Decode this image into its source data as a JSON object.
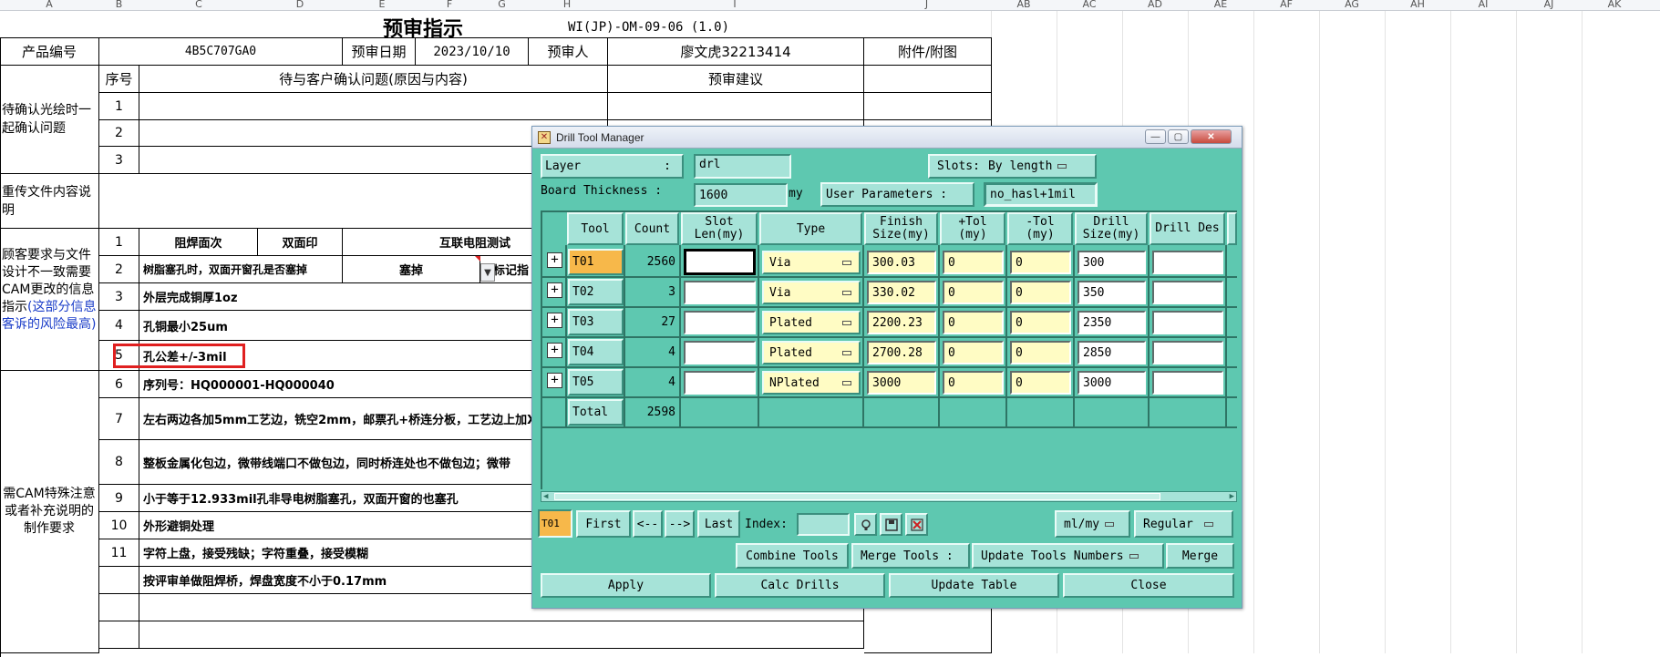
{
  "column_letters": [
    "A",
    "B",
    "C",
    "D",
    "E",
    "F",
    "G",
    "H",
    "I",
    "J",
    "AB",
    "AC",
    "AD",
    "AE",
    "AF",
    "AG",
    "AH",
    "AI",
    "AJ",
    "AK"
  ],
  "sheet": {
    "title": "预审指示",
    "doc_code": "WI(JP)-OM-09-06 (1.0)",
    "header": {
      "product_label": "产品编号",
      "product_value": "4B5C707GA0",
      "date_label": "预审日期",
      "date_value": "2023/10/10",
      "reviewer_label": "预审人",
      "reviewer_value": "廖文虎32213414",
      "attach_label": "附件/附图"
    },
    "table_head": {
      "seq": "序号",
      "issue": "待与客户确认问题(原因与内容)",
      "advice": "预审建议"
    },
    "section1": {
      "label": "待确认光绘时一起确认问题",
      "rows": [
        "1",
        "2",
        "3"
      ]
    },
    "section2": {
      "label": "重传文件内容说明"
    },
    "section3": {
      "label_black": "顾客要求与文件设计不一致需要CAM更改的信息指示",
      "label_blue": "(这部分信息客诉的风险最高)",
      "rows": [
        {
          "seq": "1",
          "a": "阻焊面次",
          "b": "双面印",
          "c": "互联电阻测试"
        },
        {
          "seq": "2",
          "a": "树脂塞孔时，双面开窗孔是否塞掉",
          "b": "塞掉",
          "c": "标记指"
        },
        {
          "seq": "3",
          "text": "外层完成铜厚1oz"
        },
        {
          "seq": "4",
          "text": "孔铜最小25um"
        },
        {
          "seq": "5",
          "text": "孔公差+/-3mil"
        }
      ]
    },
    "section4": {
      "label": "需CAM特殊注意或者补充说明的制作要求",
      "rows": [
        {
          "seq": "6",
          "text": "序列号：HQ000001-HQ000040"
        },
        {
          "seq": "7",
          "text": "左右两边各加5mm工艺边，铣空2mm，邮票孔+桥连分板，工艺边上加X"
        },
        {
          "seq": "8",
          "text": "整板金属化包边，微带线端口不做包边，同时桥连处也不做包边；微带"
        },
        {
          "seq": "9",
          "text": "小于等于12.933mil孔非导电树脂塞孔，双面开窗的也塞孔"
        },
        {
          "seq": "10",
          "text": "外形避铜处理"
        },
        {
          "seq": "11",
          "text": "字符上盘，接受残缺；字符重叠，接受模糊"
        },
        {
          "seq": "",
          "text": "按评审单做阻焊桥，焊盘宽度不小于0.17mm"
        }
      ]
    }
  },
  "dialog": {
    "title": "Drill Tool Manager",
    "layer_label": "Layer",
    "layer_colon": ":",
    "layer_value": "drl",
    "slots_label": "Slots:",
    "slots_value": "By length",
    "board_thickness_label": "Board Thickness :",
    "board_thickness_value": "1600",
    "unit_my": "my",
    "user_params_label": "User Parameters :",
    "user_params_value": "no_hasl+1mil",
    "columns": [
      "Tool",
      "Count",
      "Slot Len(my)",
      "Type",
      "Finish Size(my)",
      "+Tol (my)",
      "-Tol (my)",
      "Drill Size(my)",
      "Drill Des"
    ],
    "rows": [
      {
        "tool": "T01",
        "count": "2560",
        "slot": "",
        "type": "Via",
        "finish": "300.03",
        "ptol": "0",
        "ntol": "0",
        "drill": "300",
        "des": ""
      },
      {
        "tool": "T02",
        "count": "3",
        "slot": "",
        "type": "Via",
        "finish": "330.02",
        "ptol": "0",
        "ntol": "0",
        "drill": "350",
        "des": ""
      },
      {
        "tool": "T03",
        "count": "27",
        "slot": "",
        "type": "Plated",
        "finish": "2200.23",
        "ptol": "0",
        "ntol": "0",
        "drill": "2350",
        "des": ""
      },
      {
        "tool": "T04",
        "count": "4",
        "slot": "",
        "type": "Plated",
        "finish": "2700.28",
        "ptol": "0",
        "ntol": "0",
        "drill": "2850",
        "des": ""
      },
      {
        "tool": "T05",
        "count": "4",
        "slot": "",
        "type": "NPlated",
        "finish": "3000",
        "ptol": "0",
        "ntol": "0",
        "drill": "3000",
        "des": ""
      }
    ],
    "total_label": "Total",
    "total_value": "2598",
    "nav": {
      "current": "T01",
      "first": "First",
      "prev": "<--",
      "next": "-->",
      "last": "Last",
      "index_label": "Index:",
      "unit": "ml/my",
      "mode": "Regular"
    },
    "buttons": {
      "combine": "Combine Tools",
      "merge_label": "Merge Tools :",
      "update_numbers": "Update Tools Numbers",
      "merge": "Merge",
      "apply": "Apply",
      "calc": "Calc Drills",
      "update_table": "Update Table",
      "close": "Close"
    },
    "colors": {
      "panel": "#5ec8b0",
      "button": "#a6e3d8",
      "input": "#fffcc4",
      "selected": "#f7b84a",
      "grid_line": "#2e7565"
    }
  }
}
